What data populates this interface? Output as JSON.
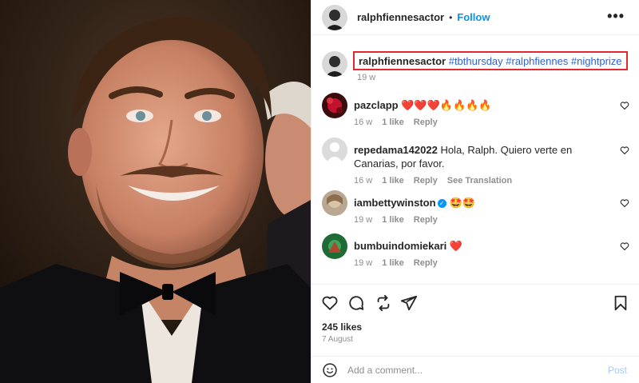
{
  "post": {
    "username": "ralphfiennesactor",
    "separator": "•",
    "follow_label": "Follow",
    "more_label": "•••"
  },
  "caption": {
    "username": "ralphfiennesactor",
    "hashtags": "#tbthursday #ralphfiennes #nightprize",
    "time": "19 w"
  },
  "comments": [
    {
      "username": "pazclapp",
      "text": "❤️❤️❤️🔥🔥🔥🔥",
      "time": "16 w",
      "likes": "1 like",
      "reply": "Reply"
    },
    {
      "username": "repedama142022",
      "text": "Hola, Ralph. Quiero verte en Canarias, por favor.",
      "time": "16 w",
      "likes": "1 like",
      "reply": "Reply",
      "translate": "See Translation"
    },
    {
      "username": "iambettywinston",
      "text": "🤩🤩",
      "time": "19 w",
      "likes": "1 like",
      "reply": "Reply"
    },
    {
      "username": "bumbuindomiekari",
      "text": "❤️",
      "time": "19 w",
      "likes": "1 like",
      "reply": "Reply"
    }
  ],
  "actions": {
    "likes": "245 likes",
    "date": "7 August"
  },
  "add_comment": {
    "placeholder": "Add a comment...",
    "post_label": "Post"
  },
  "colors": {
    "accent": "#0095f6",
    "highlight_border": "#e5282f",
    "hashtag": "#2f5fd0"
  }
}
